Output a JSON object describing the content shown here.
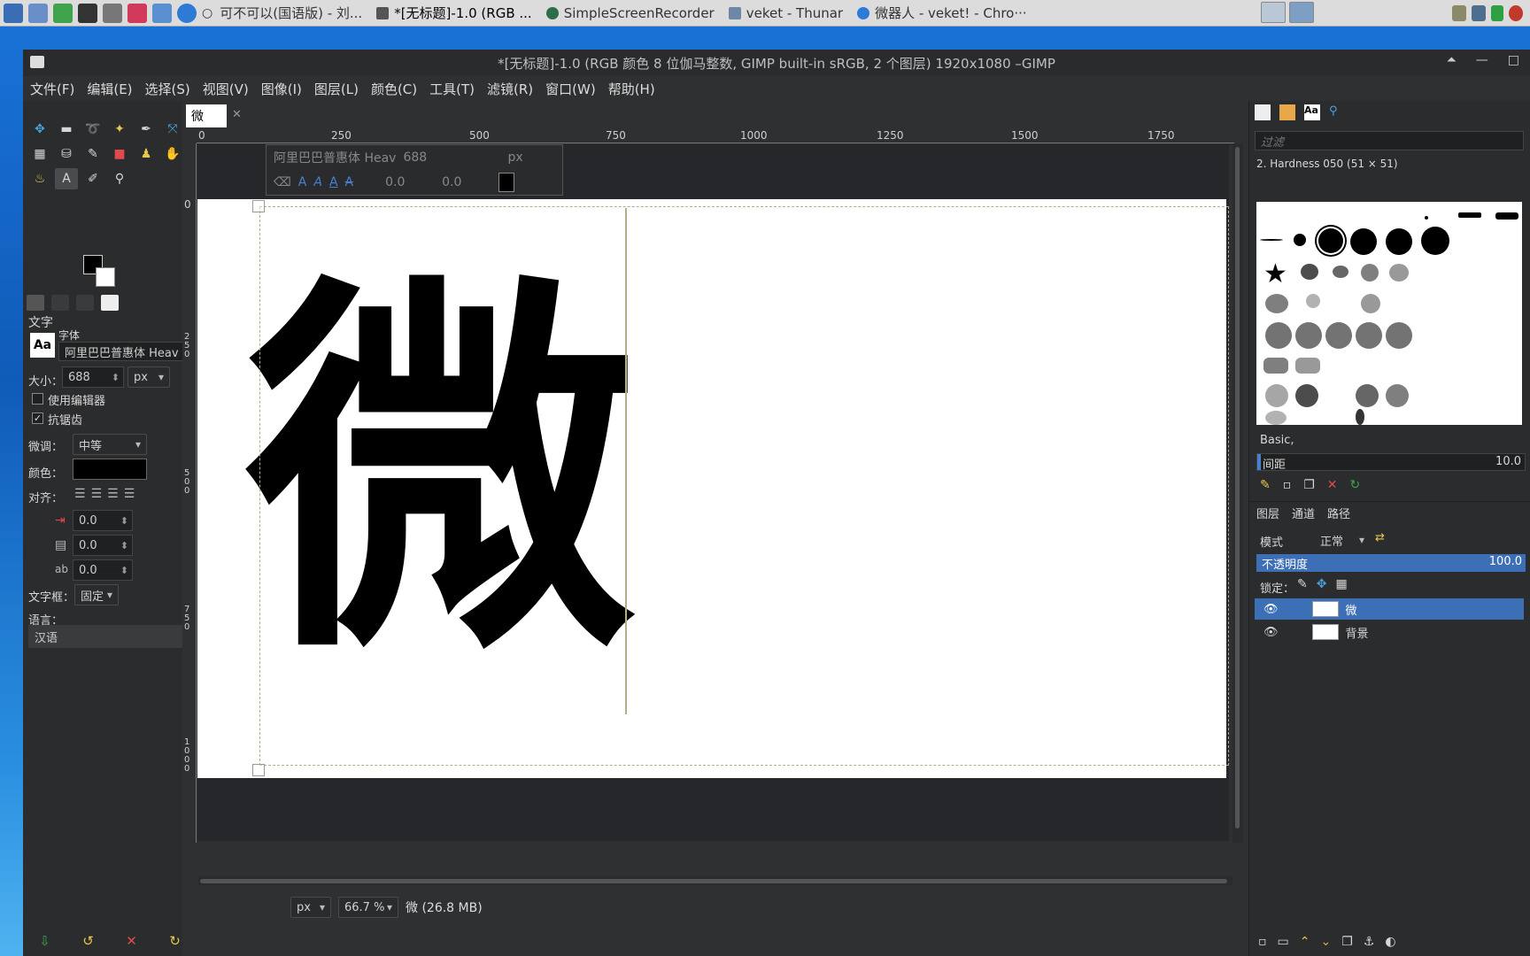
{
  "taskbar": {
    "tasks": [
      "可不可以(国语版) - 刘...",
      "*[无标题]-1.0 (RGB ...",
      "SimpleScreenRecorder",
      "veket - Thunar",
      "微器人 - veket! - Chro···"
    ]
  },
  "window": {
    "title": "*[无标题]-1.0 (RGB 颜色 8 位伽马整数, GIMP built-in sRGB, 2 个图层) 1920x1080 –GIMP",
    "menu": [
      "文件(F)",
      "编辑(E)",
      "选择(S)",
      "视图(V)",
      "图像(I)",
      "图层(L)",
      "颜色(C)",
      "工具(T)",
      "滤镜(R)",
      "窗口(W)",
      "帮助(H)"
    ]
  },
  "tool_options": {
    "section": "文字",
    "font_label": "字体",
    "font_value": "阿里巴巴普惠体 Heav",
    "size_label": "大小：",
    "size_value": "688",
    "unit": "px",
    "use_editor": "使用编辑器",
    "antialias": "抗锯齿",
    "hinting_label": "微调：",
    "hinting_value": "中等",
    "color_label": "颜色：",
    "justify_label": "对齐：",
    "indent": "0.0",
    "line_spacing": "0.0",
    "letter_spacing": "0.0",
    "box_label": "文字框：",
    "box_value": "固定",
    "language_label": "语言：",
    "language_value": "汉语"
  },
  "canvas": {
    "tab_label": "微",
    "ruler_h": [
      "0",
      "250",
      "500",
      "750",
      "1000",
      "1250",
      "1500",
      "1750"
    ],
    "ruler_v": [
      "0",
      "250",
      "500",
      "750",
      "1000"
    ],
    "char": "微",
    "ontext": {
      "font": "阿里巴巴普惠体 Heav",
      "size": "688",
      "unit": "px",
      "baseline": "0.0",
      "kerning": "0.0"
    },
    "status_unit": "px",
    "zoom": "66.7 %",
    "status_text": "微 (26.8 MB)"
  },
  "dock": {
    "filter_placeholder": "过滤",
    "brush_name": "2. Hardness 050 (51 × 51)",
    "brush_tag": "Basic,",
    "spacing_label": "间距",
    "spacing_value": "10.0",
    "tabs": [
      "图层",
      "通道",
      "路径"
    ],
    "mode_label": "模式",
    "mode_value": "正常",
    "opacity_label": "不透明度",
    "opacity_value": "100.0",
    "lock_label": "锁定：",
    "layers": [
      "微",
      "背景"
    ]
  }
}
